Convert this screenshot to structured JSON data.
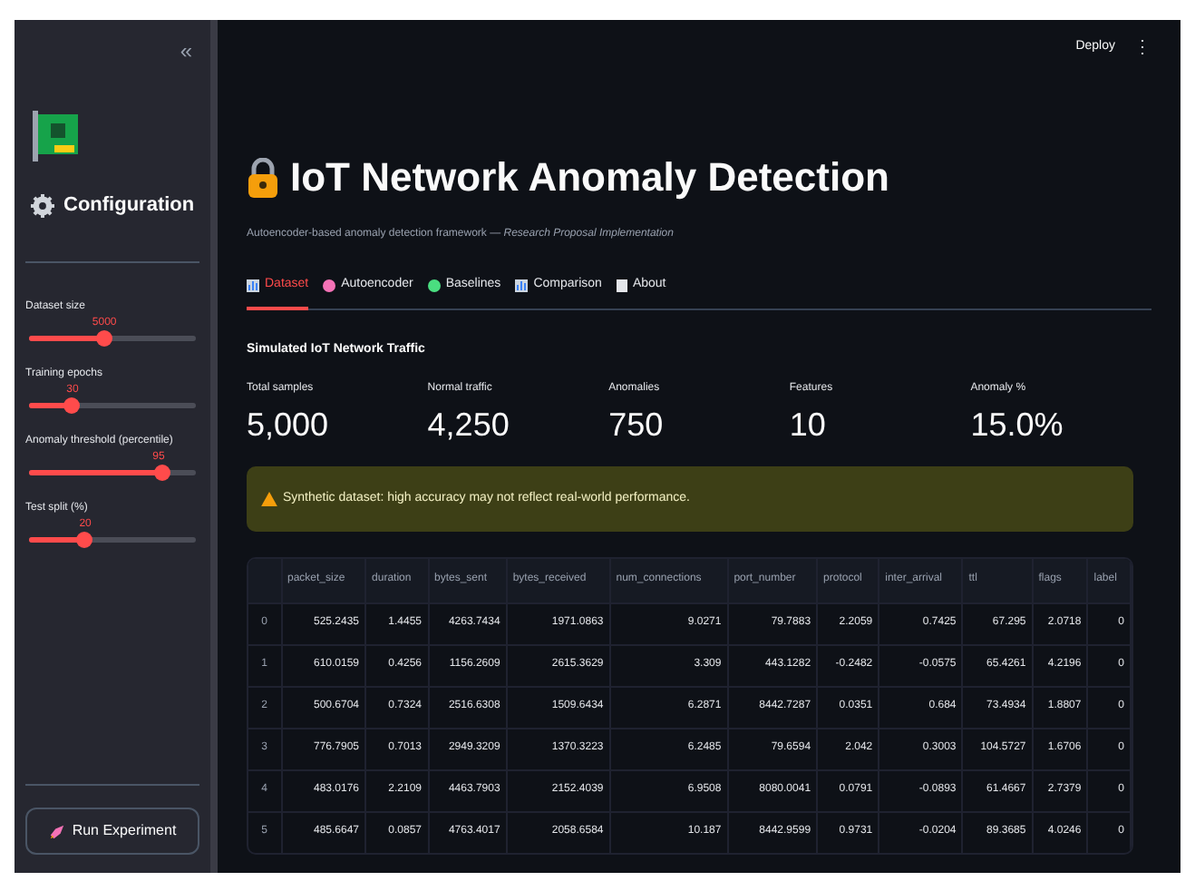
{
  "sidebar": {
    "collapse_icon": "«",
    "title": "Configuration",
    "sliders": [
      {
        "label": "Dataset size",
        "value": "5000",
        "level": 0.45
      },
      {
        "label": "Training epochs",
        "value": "30",
        "level": 0.25
      },
      {
        "label": "Anomaly threshold (percentile)",
        "value": "95",
        "level": 0.79
      },
      {
        "label": "Test split (%)",
        "value": "20",
        "level": 0.33
      }
    ],
    "run_button": "Run Experiment"
  },
  "header": {
    "deploy": "Deploy",
    "menu": "⋮"
  },
  "title": "IoT Network Anomaly Detection",
  "subtitle": "Autoencoder-based anomaly detection framework — *Research Proposal Implementation*",
  "tabs": [
    {
      "label": "Dataset",
      "selected": true,
      "kind": "chart"
    },
    {
      "label": "Autoencoder",
      "selected": false,
      "kind": "pink"
    },
    {
      "label": "Baselines",
      "selected": false,
      "kind": "green"
    },
    {
      "label": "Comparison",
      "selected": false,
      "kind": "chart"
    },
    {
      "label": "About",
      "selected": false,
      "kind": "doc"
    }
  ],
  "section_title": "Simulated IoT Network Traffic",
  "metrics": [
    {
      "label": "Total samples",
      "value": "5,000"
    },
    {
      "label": "Normal traffic",
      "value": "4,250"
    },
    {
      "label": "Anomalies",
      "value": "750"
    },
    {
      "label": "Features",
      "value": "10"
    },
    {
      "label": "Anomaly %",
      "value": "15.0%"
    }
  ],
  "warning": "Synthetic dataset: high accuracy may not reflect real-world performance.",
  "table": {
    "columns": [
      "packet_size",
      "duration",
      "bytes_sent",
      "bytes_received",
      "num_connections",
      "port_number",
      "protocol",
      "inter_arrival",
      "ttl",
      "flags",
      "label"
    ],
    "rows": [
      {
        "index": "0",
        "cells": [
          "525.2435",
          "1.4455",
          "4263.7434",
          "1971.0863",
          "9.0271",
          "79.7883",
          "2.2059",
          "0.7425",
          "67.295",
          "2.0718",
          "0"
        ]
      },
      {
        "index": "1",
        "cells": [
          "610.0159",
          "0.4256",
          "1156.2609",
          "2615.3629",
          "3.309",
          "443.1282",
          "-0.2482",
          "-0.0575",
          "65.4261",
          "4.2196",
          "0"
        ]
      },
      {
        "index": "2",
        "cells": [
          "500.6704",
          "0.7324",
          "2516.6308",
          "1509.6434",
          "6.2871",
          "8442.7287",
          "0.0351",
          "0.684",
          "73.4934",
          "1.8807",
          "0"
        ]
      },
      {
        "index": "3",
        "cells": [
          "776.7905",
          "0.7013",
          "2949.3209",
          "1370.3223",
          "6.2485",
          "79.6594",
          "2.042",
          "0.3003",
          "104.5727",
          "1.6706",
          "0"
        ]
      },
      {
        "index": "4",
        "cells": [
          "483.0176",
          "2.2109",
          "4463.7903",
          "2152.4039",
          "6.9508",
          "8080.0041",
          "0.0791",
          "-0.0893",
          "61.4667",
          "2.7379",
          "0"
        ]
      },
      {
        "index": "5",
        "cells": [
          "485.6647",
          "0.0857",
          "4763.4017",
          "2058.6584",
          "10.187",
          "8442.9599",
          "0.9731",
          "-0.0204",
          "89.3685",
          "4.0246",
          "0"
        ]
      }
    ]
  }
}
